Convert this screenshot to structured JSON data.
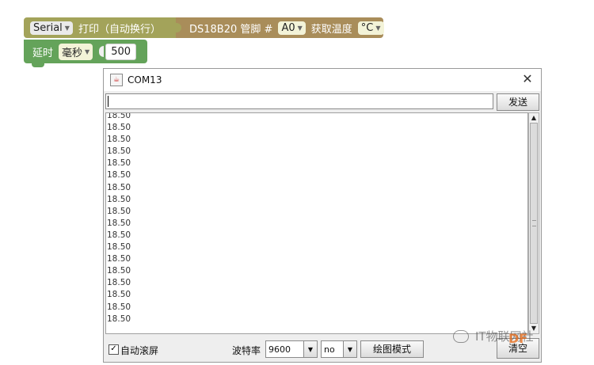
{
  "blocks": {
    "serial_port": "Serial",
    "print_label": "打印（自动换行）",
    "sensor_label": "DS18B20 管脚 #",
    "pin": "A0",
    "read_label": "获取温度",
    "unit": "°C",
    "delay_label": "延时",
    "delay_unit": "毫秒",
    "delay_value": "500"
  },
  "window": {
    "title": "COM13",
    "close": "✕",
    "send_input_value": "",
    "send_button": "发送",
    "output_lines": [
      "18.50",
      "18.50",
      "18.50",
      "18.50",
      "18.50",
      "18.50",
      "18.50",
      "18.50",
      "18.50",
      "18.50",
      "18.50",
      "18.50",
      "18.50",
      "18.50",
      "18.50",
      "18.50",
      "18.50",
      "18.50"
    ],
    "autoscroll_checked": "☑",
    "autoscroll_label": "自动滚屏",
    "baud_label": "波特率",
    "baud_value": "9600",
    "line_ending_value": "no",
    "plot_button": "绘图模式",
    "clear_button": "清空"
  },
  "watermark": {
    "text": "IT物联网社",
    "logo": "DF"
  },
  "icons": {
    "java": "java-cup-icon",
    "dropdown": "triangle-down-icon",
    "scroll_up": "triangle-up-icon",
    "scroll_down": "triangle-down-icon"
  }
}
